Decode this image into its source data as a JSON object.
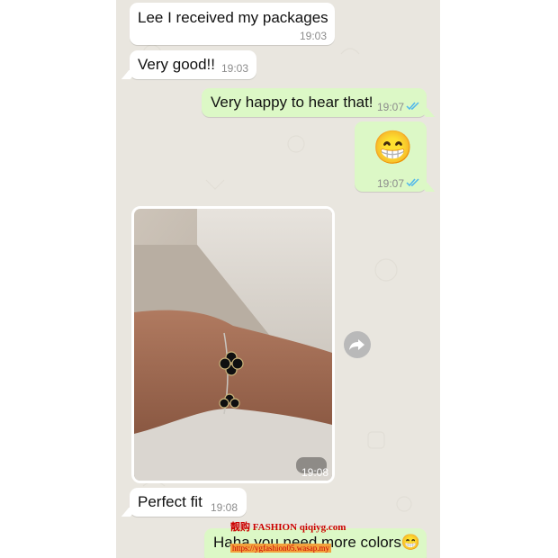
{
  "messages": [
    {
      "direction": "incoming",
      "text": "Lee I received my packages",
      "time": "19:03"
    },
    {
      "direction": "incoming",
      "text": "Very good!!",
      "time": "19:03"
    },
    {
      "direction": "outgoing",
      "text": "Very happy to hear that!",
      "time": "19:07",
      "status": "read"
    },
    {
      "direction": "outgoing",
      "text": "😁",
      "time": "19:07",
      "status": "read"
    },
    {
      "direction": "incoming",
      "type": "image",
      "image_description": "wrist wearing bracelet with black clover charms",
      "time": "19:08"
    },
    {
      "direction": "incoming",
      "text": "Perfect fit",
      "time": "19:08"
    },
    {
      "direction": "outgoing",
      "text": "Haha you need more colors😁",
      "status": "partially visible"
    }
  ],
  "watermark": {
    "brand": "靓购 FASHION qiqiyg.com",
    "url": "https://ygfashion05.wasap.my"
  },
  "colors": {
    "chat_background": "#e9e6df",
    "incoming_bubble": "#ffffff",
    "outgoing_bubble": "#dcf8c6",
    "read_ticks": "#4fb6ec",
    "timestamp": "#8c8c8c"
  },
  "icons": {
    "forward_button": "forward-arrow-icon",
    "read_receipt": "double-check-icon"
  }
}
